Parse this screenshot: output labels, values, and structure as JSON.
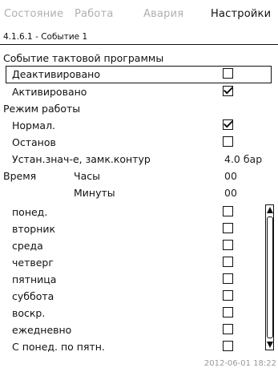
{
  "tabs": [
    "Состояние",
    "Работа",
    "Авария",
    "Настройки"
  ],
  "active_tab_index": 3,
  "breadcrumb": "4.1.6.1 - Событие 1",
  "section_title": "Событие тактовой программы",
  "activation": {
    "deactivated": {
      "label": "Деактивировано",
      "checked": false
    },
    "activated": {
      "label": "Активировано",
      "checked": true
    }
  },
  "mode": {
    "title": "Режим работы",
    "normal": {
      "label": "Нормал.",
      "checked": true
    },
    "stop": {
      "label": "Останов",
      "checked": false
    },
    "setpoint": {
      "label": "Устан.знач-е, замк.контур",
      "value": "4.0 бар"
    }
  },
  "time": {
    "title": "Время",
    "hours_label": "Часы",
    "hours_value": "00",
    "minutes_label": "Минуты",
    "minutes_value": "00"
  },
  "days": [
    {
      "label": "понед.",
      "checked": false
    },
    {
      "label": "вторник",
      "checked": false
    },
    {
      "label": "среда",
      "checked": false
    },
    {
      "label": "четверг",
      "checked": false
    },
    {
      "label": "пятница",
      "checked": false
    },
    {
      "label": "суббота",
      "checked": false
    },
    {
      "label": "воскр.",
      "checked": false
    },
    {
      "label": "ежедневно",
      "checked": false
    },
    {
      "label": "С понед. по пятн.",
      "checked": false
    }
  ],
  "status_datetime": "2012-06-01 18:22"
}
